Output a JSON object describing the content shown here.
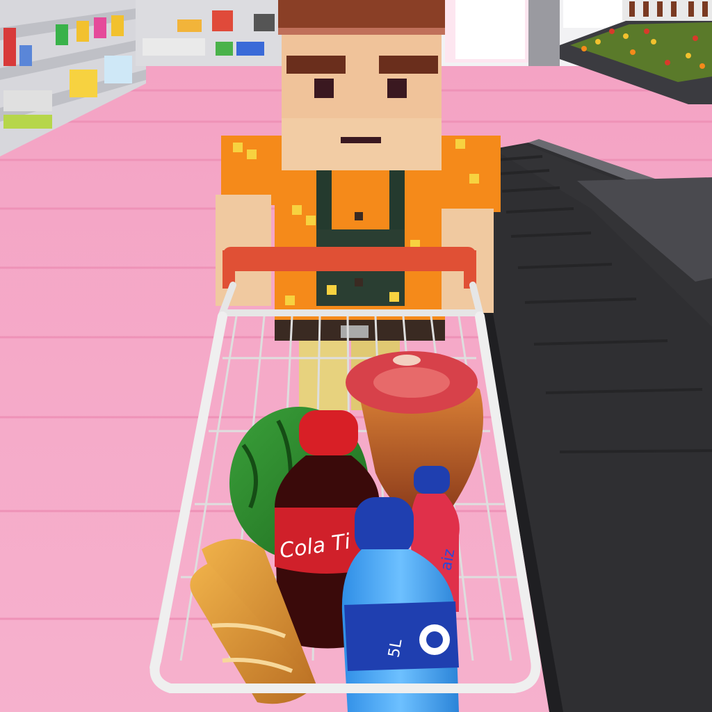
{
  "scene": {
    "type": "3d-supermarket-checkout",
    "colors": {
      "floor": "#f5a8c6",
      "floor_stripe": "#ee92b7",
      "wall": "#ffffff",
      "shelf": "#d9d9de",
      "conveyor": "#3a3a3c",
      "counter": "#2b2b2d",
      "cart_frame": "#e6e6e6",
      "handle": "#e05035",
      "shirt": "#f58a1a",
      "skin": "#f0c9a0",
      "hair": "#7a3a22",
      "watermelon": "#2f8a2a",
      "cola_cap": "#d81f26",
      "cola_body": "#3a0a0a",
      "water_body": "#3aa0f0",
      "water_cap": "#1f3fb0",
      "juice_body": "#e0304a",
      "bread": "#d99a3a",
      "meat": "#d7414a"
    }
  },
  "labels": {
    "cola_brand": "Cola Ti",
    "water_volume": "5L",
    "juice_brand": "aiz"
  }
}
